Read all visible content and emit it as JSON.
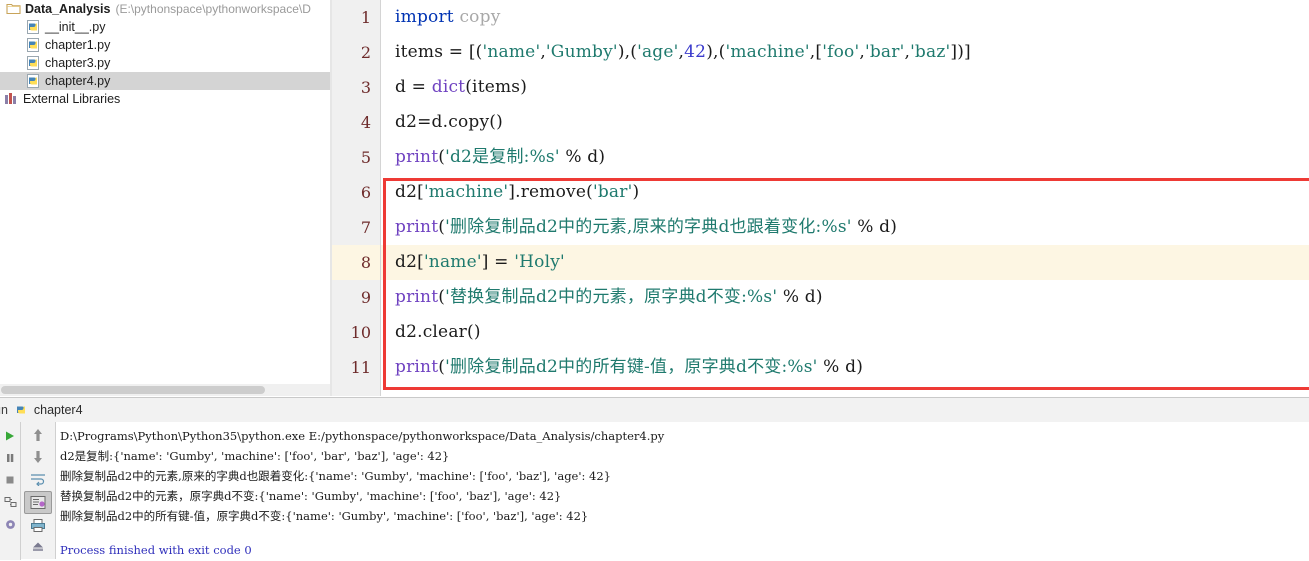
{
  "project": {
    "root": {
      "name": "Data_Analysis",
      "path": "(E:\\pythonspace\\pythonworkspace\\D",
      "icon": "folder-icon"
    },
    "items": [
      {
        "label": "__init__.py",
        "icon": "python-file-icon",
        "selected": false
      },
      {
        "label": "chapter1.py",
        "icon": "python-file-icon",
        "selected": false
      },
      {
        "label": "chapter3.py",
        "icon": "python-file-icon",
        "selected": false
      },
      {
        "label": "chapter4.py",
        "icon": "python-file-icon",
        "selected": true
      }
    ],
    "external_libraries": {
      "label": "External Libraries",
      "icon": "libraries-icon"
    }
  },
  "editor": {
    "current_line": 8,
    "highlight_box": {
      "from_line": 6,
      "to_line": 11,
      "color": "#ee3a35"
    },
    "lines": [
      {
        "n": "1",
        "text": "import copy"
      },
      {
        "n": "2",
        "text": "items = [('name','Gumby'),('age',42),('machine',['foo','bar','baz'])]"
      },
      {
        "n": "3",
        "text": "d = dict(items)"
      },
      {
        "n": "4",
        "text": "d2=d.copy()"
      },
      {
        "n": "5",
        "text": "print('d2是复制:%s' % d)"
      },
      {
        "n": "6",
        "text": "d2['machine'].remove('bar')"
      },
      {
        "n": "7",
        "text": "print('删除复制品d2中的元素,原来的字典d也跟着变化:%s' % d)"
      },
      {
        "n": "8",
        "text": "d2['name'] = 'Holy'"
      },
      {
        "n": "9",
        "text": "print('替换复制品d2中的元素，原字典d不变:%s' % d)"
      },
      {
        "n": "10",
        "text": "d2.clear()"
      },
      {
        "n": "11",
        "text": "print('删除复制品d2中的所有键-值，原字典d不变:%s' % d)"
      }
    ],
    "syntax_colors": {
      "keyword": "#0033b3",
      "function": "#6f42c1",
      "string": "#1f7a6e",
      "number": "#3b3bcc",
      "unused": "#a8a8a8",
      "line_number": "#6e2b2b",
      "current_line_bg": "#fdf6e3"
    }
  },
  "run_window": {
    "tool_label": "un",
    "tab_label": "chapter4",
    "tab_icon": "python-file-icon",
    "left_rail_icons": [
      "run-icon",
      "pause-icon",
      "stop-icon",
      "toggle-tasks-icon",
      "settings-icon"
    ],
    "toolbar_icons": [
      "scroll-up-icon",
      "scroll-down-icon",
      "soft-wrap-icon",
      "scroll-to-end-icon",
      "print-icon",
      "clear-all-icon"
    ],
    "console": [
      {
        "text": "D:\\Programs\\Python\\Python35\\python.exe E:/pythonspace/pythonworkspace/Data_Analysis/chapter4.py",
        "style": "normal"
      },
      {
        "text": "d2是复制:{'name': 'Gumby', 'machine': ['foo', 'bar', 'baz'], 'age': 42}",
        "style": "normal"
      },
      {
        "text": "删除复制品d2中的元素,原来的字典d也跟着变化:{'name': 'Gumby', 'machine': ['foo', 'baz'], 'age': 42}",
        "style": "normal"
      },
      {
        "text": "替换复制品d2中的元素，原字典d不变:{'name': 'Gumby', 'machine': ['foo', 'baz'], 'age': 42}",
        "style": "normal"
      },
      {
        "text": "删除复制品d2中的所有键-值，原字典d不变:{'name': 'Gumby', 'machine': ['foo', 'baz'], 'age': 42}",
        "style": "normal"
      },
      {
        "text": "",
        "style": "spacer"
      },
      {
        "text": "Process finished with exit code 0",
        "style": "blue"
      }
    ]
  }
}
